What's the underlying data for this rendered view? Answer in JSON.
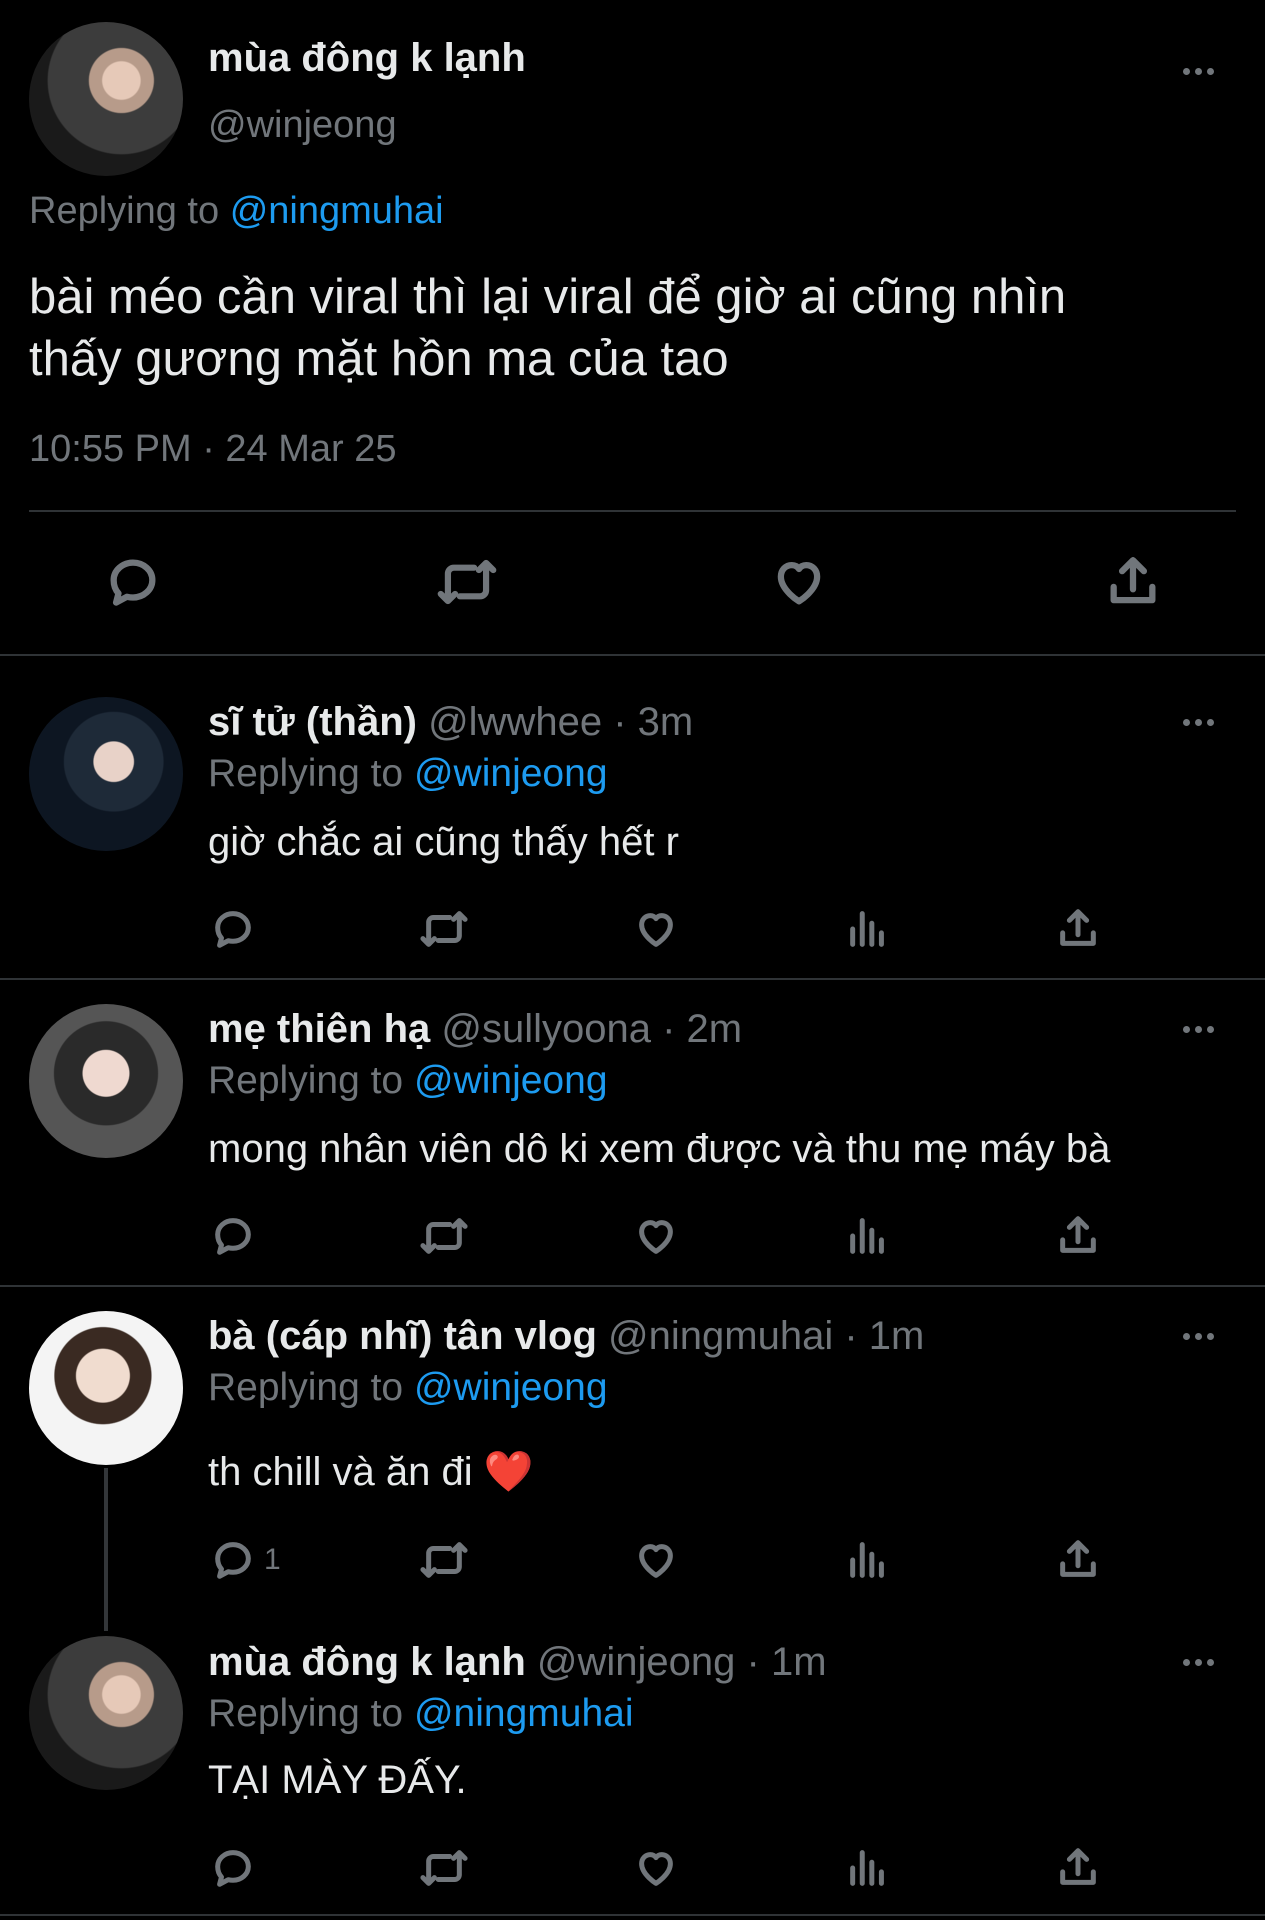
{
  "main_tweet": {
    "display_name": "mùa đông k lạnh",
    "handle": "@winjeong",
    "replying_prefix": "Replying to",
    "replying_to": "@ningmuhai",
    "text_line1": "bài méo cần viral thì lại viral để giờ ai cũng nhìn",
    "text_line2": "thấy gương mặt hồn ma của tao",
    "timestamp": "10:55 PM · 24 Mar 25"
  },
  "replies": [
    {
      "display_name": "sĩ tử (thần)",
      "meta": "@lwwhee · 3m",
      "replying_prefix": "Replying to",
      "replying_to": "@winjeong",
      "text": "giờ chắc ai cũng thấy hết r"
    },
    {
      "display_name": "mẹ thiên hạ",
      "meta": "@sullyoona · 2m",
      "replying_prefix": "Replying to",
      "replying_to": "@winjeong",
      "text": "mong nhân viên dô ki xem được và thu mẹ máy bà"
    },
    {
      "display_name": "bà (cáp nhĩ) tân vlog",
      "meta": "@ningmuhai · 1m",
      "replying_prefix": "Replying to",
      "replying_to": "@winjeong",
      "text": "th chill và ăn đi ❤️",
      "reply_count": "1"
    },
    {
      "display_name": "mùa đông k lạnh",
      "meta": "@winjeong · 1m",
      "replying_prefix": "Replying to",
      "replying_to": "@ningmuhai",
      "text": "TẠI MÀY ĐẤY."
    }
  ],
  "icons": {
    "reply": "reply-icon",
    "retweet": "retweet-icon",
    "like": "like-icon",
    "views": "views-icon",
    "share": "share-icon",
    "more": "more-icon"
  },
  "colors": {
    "background": "#000000",
    "text": "#e7e9ea",
    "muted": "#71767b",
    "link": "#1d9bf0",
    "divider": "#2f3336"
  }
}
